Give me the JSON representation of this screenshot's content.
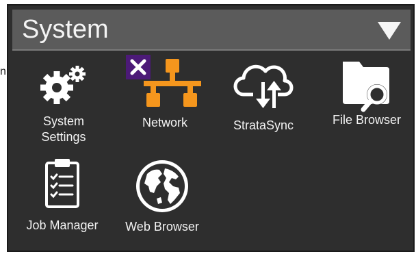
{
  "window": {
    "stray_char": "n"
  },
  "header": {
    "title": "System",
    "dropdown_icon": "caret-down-icon"
  },
  "apps": [
    {
      "label_line1": "System",
      "label_line2": "Settings",
      "icon": "gears-icon"
    },
    {
      "label": "Network",
      "icon": "network-icon",
      "badge_icon": "close-x-icon",
      "badge_color": "#4c1a78",
      "icon_color": "#f5961d"
    },
    {
      "label": "StrataSync",
      "icon": "cloud-sync-icon"
    },
    {
      "label": "File Browser",
      "icon": "folder-search-icon"
    },
    {
      "label": "Job Manager",
      "icon": "clipboard-checklist-icon"
    },
    {
      "label": "Web Browser",
      "icon": "globe-icon"
    }
  ],
  "colors": {
    "panel_bg": "#2e2e2e",
    "header_bg": "#5b5b5b",
    "text": "#f2f2f2",
    "network_orange": "#f5961d",
    "badge_purple": "#4c1a78"
  }
}
